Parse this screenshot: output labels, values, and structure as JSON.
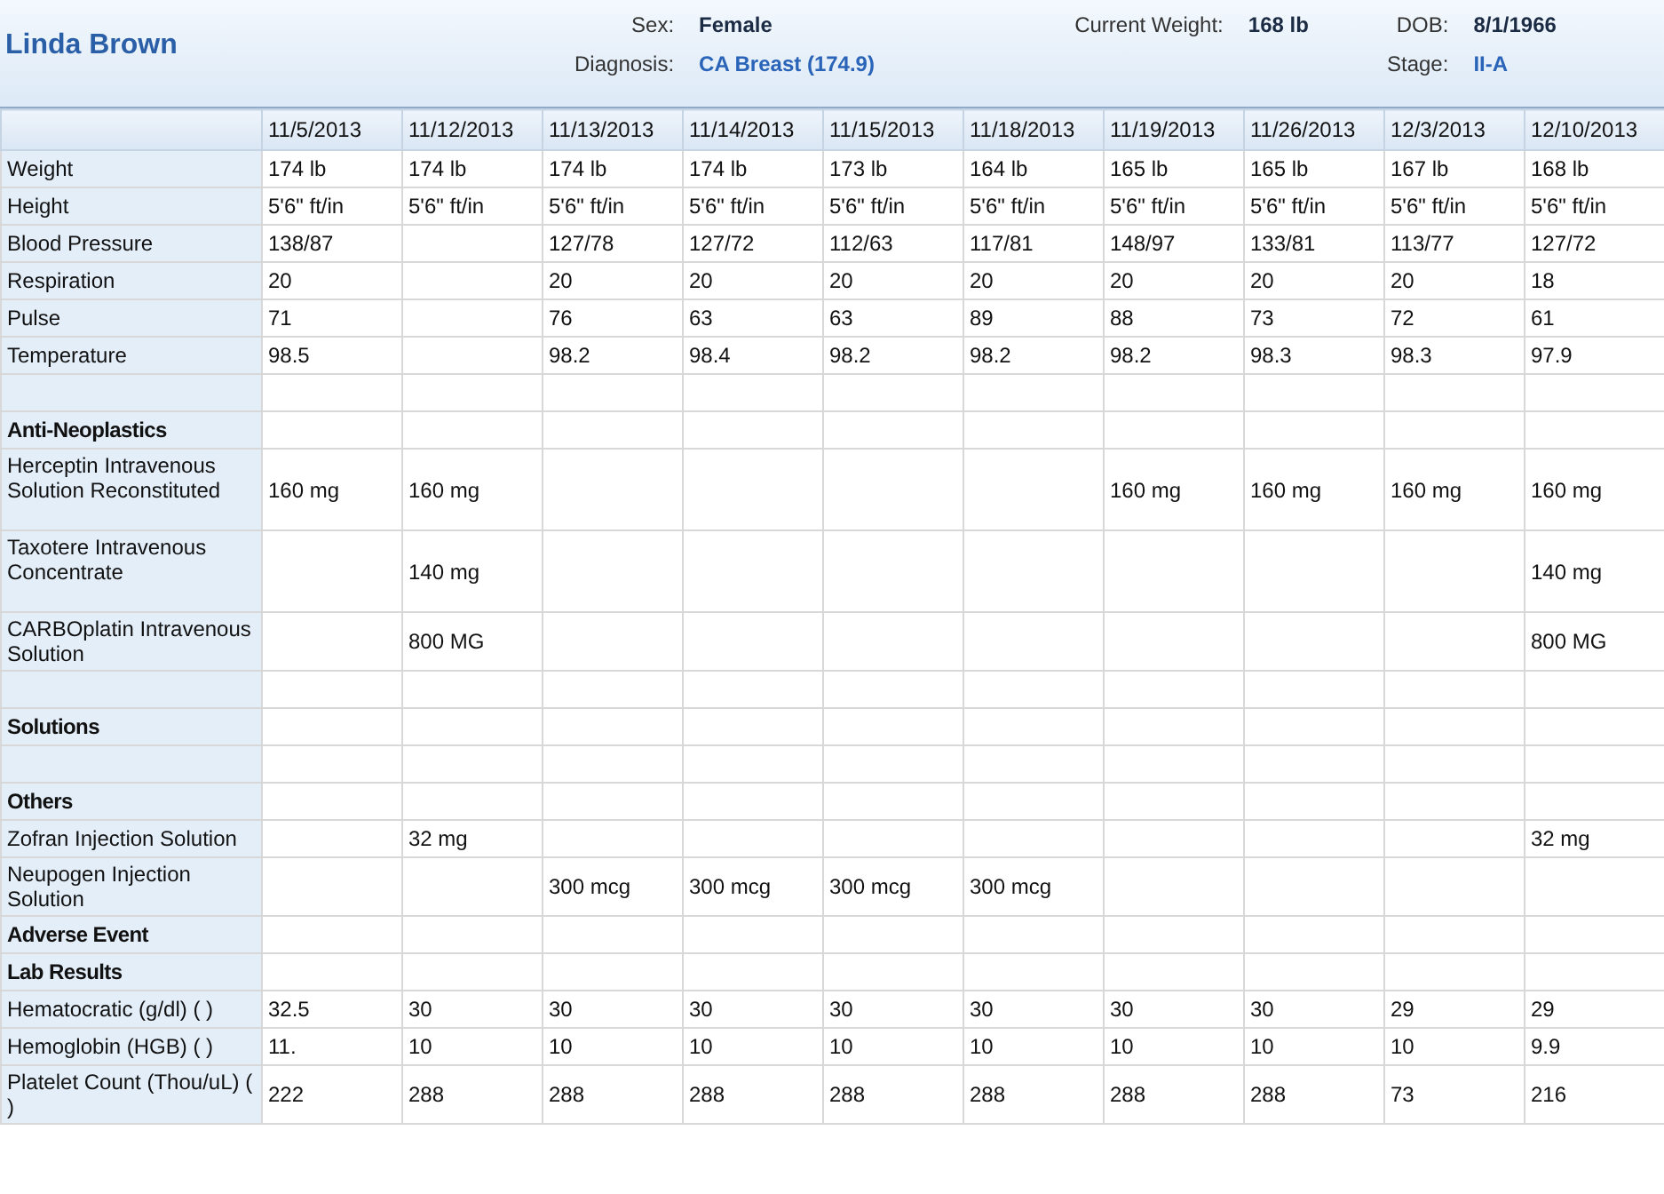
{
  "patient": {
    "name": "Linda Brown"
  },
  "header_groups": [
    [
      {
        "label": "Sex:",
        "value": "Female",
        "kind": "plain"
      },
      {
        "label": "Diagnosis:",
        "value": "CA Breast (174.9)",
        "kind": "coded"
      }
    ],
    [
      {
        "label": "Current Weight:",
        "value": "168 lb",
        "kind": "plain"
      }
    ],
    [
      {
        "label": "DOB:",
        "value": "8/1/1966",
        "kind": "plain"
      },
      {
        "label": "Stage:",
        "value": "II-A",
        "kind": "coded"
      }
    ]
  ],
  "table": {
    "columns": [
      "11/5/2013",
      "11/12/2013",
      "11/13/2013",
      "11/14/2013",
      "11/15/2013",
      "11/18/2013",
      "11/19/2013",
      "11/26/2013",
      "12/3/2013",
      "12/10/2013"
    ],
    "rows": [
      {
        "kind": "item",
        "label": "Weight",
        "cells": [
          "174 lb",
          "174 lb",
          "174 lb",
          "174 lb",
          "173 lb",
          "164 lb",
          "165 lb",
          "165 lb",
          "167 lb",
          "168 lb"
        ]
      },
      {
        "kind": "item",
        "label": "Height",
        "cells": [
          "5'6\" ft/in",
          "5'6\" ft/in",
          "5'6\" ft/in",
          "5'6\" ft/in",
          "5'6\" ft/in",
          "5'6\" ft/in",
          "5'6\" ft/in",
          "5'6\" ft/in",
          "5'6\" ft/in",
          "5'6\" ft/in"
        ]
      },
      {
        "kind": "item",
        "label": "Blood Pressure",
        "cells": [
          "138/87",
          null,
          "127/78",
          "127/72",
          "112/63",
          "117/81",
          "148/97",
          "133/81",
          "113/77",
          "127/72"
        ]
      },
      {
        "kind": "item",
        "label": "Respiration",
        "cells": [
          "20",
          null,
          "20",
          "20",
          "20",
          "20",
          "20",
          "20",
          "20",
          "18"
        ]
      },
      {
        "kind": "item",
        "label": "Pulse",
        "cells": [
          "71",
          null,
          "76",
          "63",
          "63",
          "89",
          "88",
          "73",
          "72",
          "61"
        ]
      },
      {
        "kind": "item",
        "label": "Temperature",
        "cells": [
          "98.5",
          null,
          "98.2",
          "98.4",
          "98.2",
          "98.2",
          "98.2",
          "98.3",
          "98.3",
          "97.9"
        ]
      },
      {
        "kind": "blank"
      },
      {
        "kind": "section",
        "label": "Anti-Neoplastics"
      },
      {
        "kind": "drug",
        "label": "Herceptin Intravenous Solution Reconstituted",
        "cells": [
          "160 mg",
          "160 mg",
          null,
          null,
          null,
          null,
          "160 mg",
          "160 mg",
          "160 mg",
          "160 mg"
        ]
      },
      {
        "kind": "drug",
        "label": "Taxotere Intravenous Concentrate",
        "cells": [
          null,
          "140 mg",
          null,
          null,
          null,
          null,
          null,
          null,
          null,
          "140 mg"
        ]
      },
      {
        "kind": "item",
        "label": "CARBOplatin Intravenous Solution",
        "cells": [
          null,
          "800 MG",
          null,
          null,
          null,
          null,
          null,
          null,
          null,
          "800 MG"
        ]
      },
      {
        "kind": "blank"
      },
      {
        "kind": "section",
        "label": "Solutions"
      },
      {
        "kind": "blank"
      },
      {
        "kind": "section",
        "label": "Others"
      },
      {
        "kind": "item",
        "label": "Zofran Injection Solution",
        "cells": [
          null,
          "32 mg",
          null,
          null,
          null,
          null,
          null,
          null,
          null,
          "32 mg"
        ]
      },
      {
        "kind": "item",
        "label": "Neupogen Injection Solution",
        "cells": [
          null,
          null,
          "300 mcg",
          "300 mcg",
          "300 mcg",
          "300 mcg",
          null,
          null,
          null,
          null
        ]
      },
      {
        "kind": "section",
        "label": "Adverse Event"
      },
      {
        "kind": "section",
        "label": "Lab Results"
      },
      {
        "kind": "item",
        "label": "Hematocratic (g/dl) ( )",
        "cells": [
          "32.5",
          "30",
          "30",
          "30",
          "30",
          "30",
          "30",
          "30",
          "29",
          "29"
        ]
      },
      {
        "kind": "item",
        "label": "Hemoglobin (HGB) ( )",
        "cells": [
          "11.",
          "10",
          "10",
          "10",
          "10",
          "10",
          "10",
          "10",
          "10",
          "9.9"
        ]
      },
      {
        "kind": "item",
        "label": "Platelet Count (Thou/uL) ( )",
        "cells": [
          "222",
          "288",
          "288",
          "288",
          "288",
          "288",
          "288",
          "288",
          "73",
          "216"
        ]
      }
    ]
  }
}
